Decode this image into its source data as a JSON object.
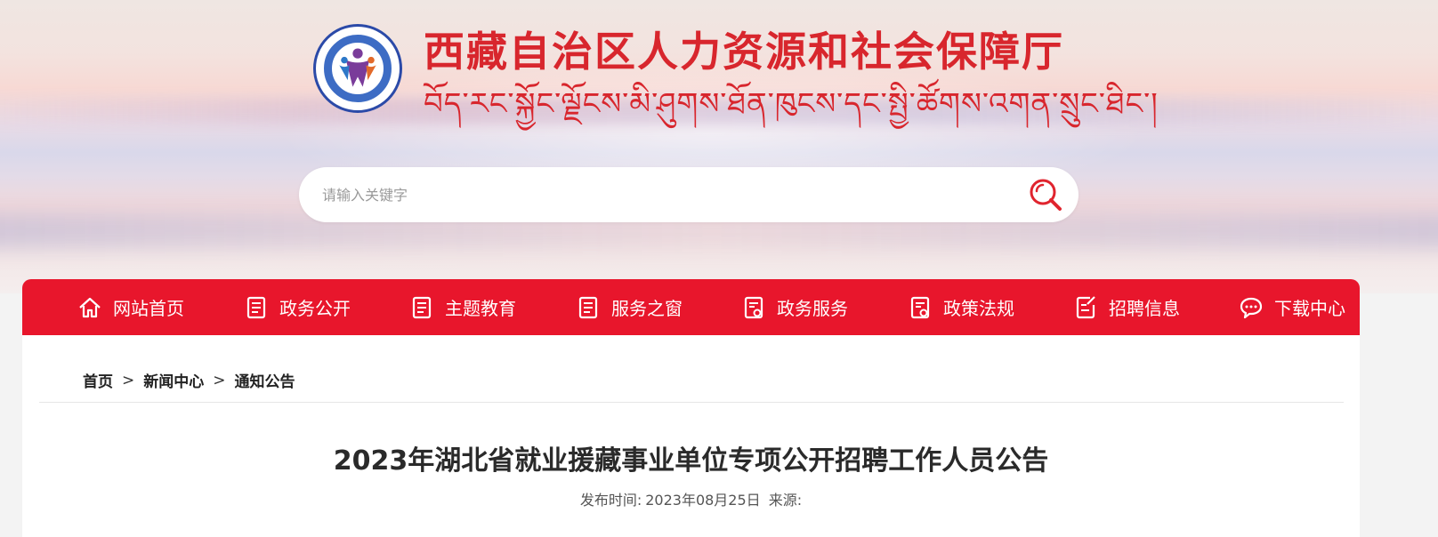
{
  "header": {
    "title_cn": "西藏自治区人力资源和社会保障厅",
    "title_tibetan": "བོད་རང་སྐྱོང་ལྗོངས་མི་ཤུགས་ཐོན་ཁུངས་དང་སྤྱི་ཚོགས་འགན་སྲུང་ཐིང་།",
    "logo_icon": "department-emblem-icon"
  },
  "search": {
    "placeholder": "请输入关键字",
    "value": "",
    "icon": "search-icon"
  },
  "nav": {
    "items": [
      {
        "label": "网站首页",
        "icon": "home-icon"
      },
      {
        "label": "政务公开",
        "icon": "document-icon"
      },
      {
        "label": "主题教育",
        "icon": "document-icon"
      },
      {
        "label": "服务之窗",
        "icon": "document-icon"
      },
      {
        "label": "政务服务",
        "icon": "document-search-icon"
      },
      {
        "label": "政策法规",
        "icon": "document-search-icon"
      },
      {
        "label": "招聘信息",
        "icon": "edit-document-icon"
      },
      {
        "label": "下载中心",
        "icon": "chat-icon"
      }
    ]
  },
  "breadcrumb": {
    "items": [
      "首页",
      "新闻中心",
      "通知公告"
    ],
    "separator": ">"
  },
  "article": {
    "title": "2023年湖北省就业援藏事业单位专项公开招聘工作人员公告",
    "published_label": "发布时间:",
    "published_date": "2023年08月25日",
    "source_label": "来源:"
  },
  "colors": {
    "accent_red": "#e8162c",
    "title_red": "#d8262d"
  }
}
